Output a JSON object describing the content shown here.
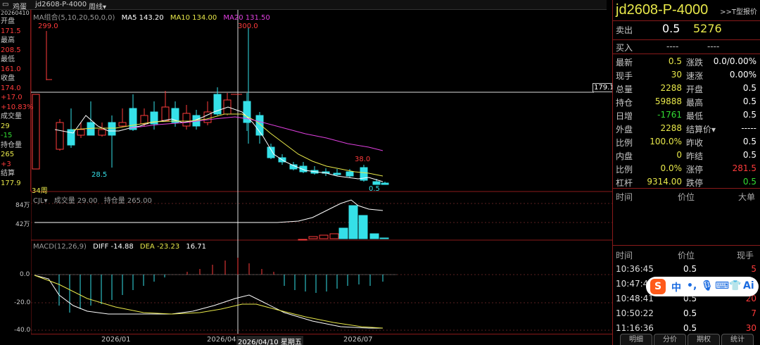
{
  "topbar": {
    "name": "鸡蛋",
    "code": "jd2608-P-4000",
    "period": "周线"
  },
  "left_info": {
    "date": "20260410",
    "open_label": "开盘",
    "open": "171.5",
    "high_label": "最高",
    "high": "208.5",
    "low_label": "最低",
    "low": "161.0",
    "close_label": "收盘",
    "close": "174.0",
    "change": "+17.0",
    "change_pct": "+10.83%",
    "vol_label": "成交量",
    "vol": "29",
    "vol_change": "-15",
    "oi_label": "持仓量",
    "oi": "265",
    "oi_change": "+3",
    "settle_label": "结算",
    "settle": "177.9"
  },
  "chart": {
    "ma_header": "MA组合(5,10,20,50,0,0)",
    "ma5": "MA5 143.20",
    "ma10": "MA10 134.00",
    "ma20": "MA20 131.50",
    "max_label": "299.0",
    "max_label2": "300.0",
    "min_label": "28.5",
    "label_38": "38.0",
    "label_05": "0.5",
    "price_tag": "179.1",
    "weeks": "34周",
    "vol_header": "CJL",
    "vol_text": "成交量 29.00",
    "oi_text": "持仓量 265.00",
    "vol_ticks": [
      "84万",
      "42万"
    ],
    "macd_header": "MACD(12,26,9)",
    "diff": "DIFF -14.88",
    "dea": "DEA -23.23",
    "macd_val": "16.71",
    "macd_ticks": [
      "0.0",
      "-20.0",
      "-40.0"
    ],
    "x_labels": [
      "2026/01",
      "2026/04",
      "2026/04/10 星期五",
      "2026/07"
    ]
  },
  "right": {
    "title": "jd2608-P-4000",
    "tbtn": ">>T型报价",
    "sell_label": "卖出",
    "sell_price": "0.5",
    "sell_qty": "5276",
    "buy_label": "买入",
    "buy_price": "----",
    "buy_qty": "----",
    "rows": [
      {
        "l1": "最新",
        "v1": "0.5",
        "l2": "涨跌",
        "v2": "0.0/0.00%"
      },
      {
        "l1": "现手",
        "v1": "30",
        "l2": "速涨",
        "v2": "0.00%"
      },
      {
        "l1": "总量",
        "v1": "2288",
        "l2": "开盘",
        "v2": "0.5"
      },
      {
        "l1": "持仓",
        "v1": "59888",
        "l2": "最高",
        "v2": "0.5"
      },
      {
        "l1": "日增",
        "v1": "-1761",
        "l2": "最低",
        "v2": "0.5"
      },
      {
        "l1": "外盘",
        "v1": "2288",
        "l2": "结算价▾",
        "v2": "-----"
      },
      {
        "l1": "比例",
        "v1": "100.0%",
        "l2": "昨收",
        "v2": "0.5"
      },
      {
        "l1": "内盘",
        "v1": "0",
        "l2": "昨结",
        "v2": "0.5"
      },
      {
        "l1": "比例",
        "v1": "0.0%",
        "l2": "涨停",
        "v2": "281.5"
      },
      {
        "l1": "杠杆",
        "v1": "9314.00",
        "l2": "跌停",
        "v2": "0.5"
      }
    ],
    "big_header": {
      "time": "时间",
      "price": "价位",
      "big": "大单"
    },
    "tick_header": {
      "time": "时间",
      "price": "价位",
      "qty": "现手"
    },
    "ticks": [
      {
        "time": "10:36:45",
        "price": "0.5",
        "qty": "5"
      },
      {
        "time": "10:47:46",
        "price": "0.5",
        "qty": "10"
      },
      {
        "time": "10:48:41",
        "price": "0.5",
        "qty": "20"
      },
      {
        "time": "10:50:22",
        "price": "0.5",
        "qty": "7"
      },
      {
        "time": "11:16:36",
        "price": "0.5",
        "qty": "30"
      }
    ],
    "tabs": [
      "明细",
      "分价",
      "期权",
      "统计"
    ]
  },
  "ime": {
    "logo": "S",
    "lang": "中",
    "ai": "Ai"
  },
  "colors": {
    "up": "#ff3b3b",
    "down": "#35e0e8",
    "ma5": "#ffffff",
    "ma10": "#e8e84a",
    "ma20": "#e040e0",
    "frame": "#8a1a1a"
  }
}
